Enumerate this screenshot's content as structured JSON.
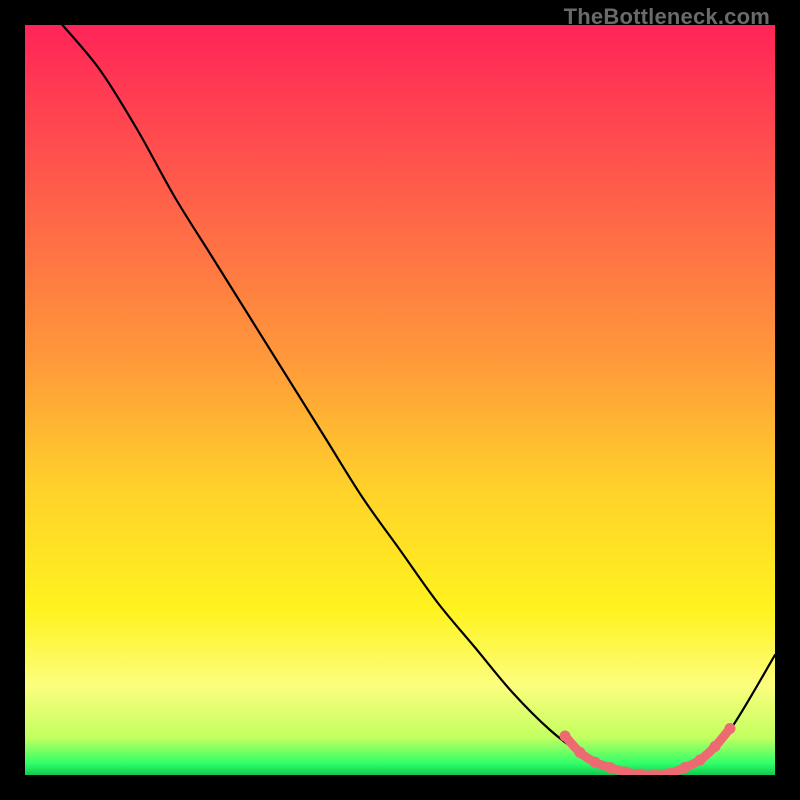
{
  "watermark": "TheBottleneck.com",
  "chart_data": {
    "type": "line",
    "title": "",
    "xlabel": "",
    "ylabel": "",
    "xlim": [
      0,
      100
    ],
    "ylim": [
      0,
      100
    ],
    "grid": false,
    "series": [
      {
        "name": "curve",
        "color": "#000000",
        "x": [
          5,
          10,
          15,
          20,
          25,
          30,
          35,
          40,
          45,
          50,
          55,
          60,
          65,
          70,
          74,
          78,
          82,
          86,
          90,
          94,
          100
        ],
        "y": [
          100,
          94,
          86,
          77,
          69,
          61,
          53,
          45,
          37,
          30,
          23,
          17,
          11,
          6,
          3,
          1,
          0,
          0,
          2,
          6,
          16
        ]
      },
      {
        "name": "minimum-marker",
        "color": "#ee6a72",
        "marker": true,
        "x": [
          72,
          74,
          76,
          78,
          80,
          82,
          84,
          86,
          88,
          90,
          92,
          94
        ],
        "y": [
          5.2,
          3.0,
          1.7,
          1.0,
          0.4,
          0.1,
          0.0,
          0.2,
          1.0,
          2.0,
          3.8,
          6.2
        ]
      }
    ],
    "background_gradient": {
      "stops": [
        {
          "offset": 0.0,
          "color": "#ff2458"
        },
        {
          "offset": 0.22,
          "color": "#ff5d4a"
        },
        {
          "offset": 0.45,
          "color": "#ff9a3a"
        },
        {
          "offset": 0.62,
          "color": "#ffd22a"
        },
        {
          "offset": 0.78,
          "color": "#fff31e"
        },
        {
          "offset": 0.88,
          "color": "#fcfe7e"
        },
        {
          "offset": 0.95,
          "color": "#c3ff60"
        },
        {
          "offset": 0.985,
          "color": "#2eff69"
        },
        {
          "offset": 1.0,
          "color": "#13c94f"
        }
      ]
    }
  }
}
